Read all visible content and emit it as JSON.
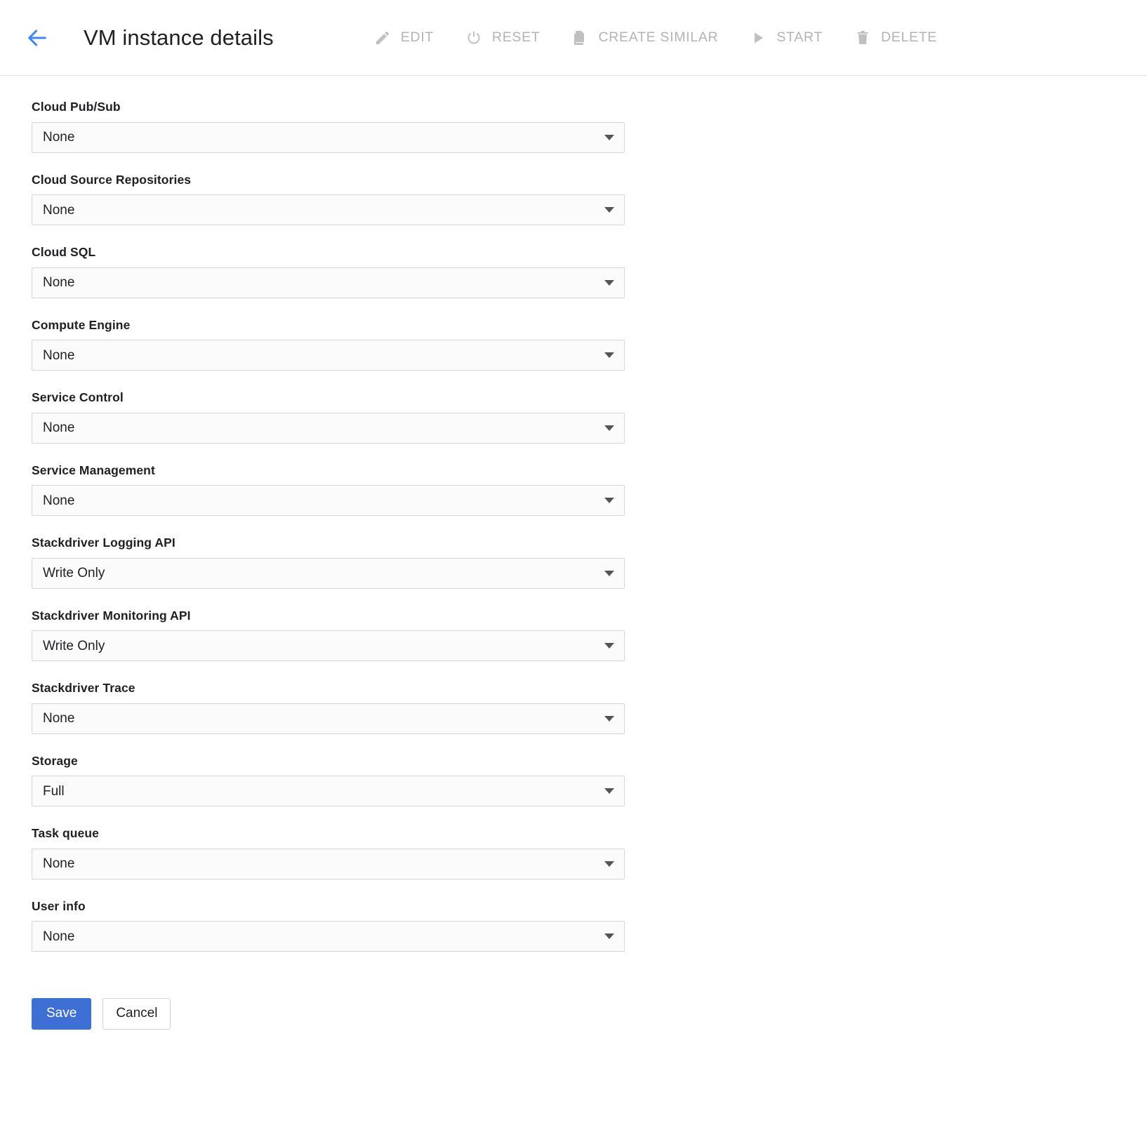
{
  "header": {
    "back_icon": "arrow-left-icon",
    "title": "VM instance details",
    "accent_color": "#4285f4",
    "toolbar_disabled_color": "#b4b4b4",
    "actions": [
      {
        "label": "EDIT",
        "icon": "pencil-icon",
        "disabled": true
      },
      {
        "label": "RESET",
        "icon": "power-reset-icon",
        "disabled": true
      },
      {
        "label": "CREATE SIMILAR",
        "icon": "duplicate-document-icon",
        "disabled": true
      },
      {
        "label": "START",
        "icon": "play-icon",
        "disabled": true
      },
      {
        "label": "DELETE",
        "icon": "trash-icon",
        "disabled": true
      }
    ]
  },
  "form": {
    "fields": [
      {
        "label": "Cloud Pub/Sub",
        "value": "None"
      },
      {
        "label": "Cloud Source Repositories",
        "value": "None"
      },
      {
        "label": "Cloud SQL",
        "value": "None"
      },
      {
        "label": "Compute Engine",
        "value": "None"
      },
      {
        "label": "Service Control",
        "value": "None"
      },
      {
        "label": "Service Management",
        "value": "None"
      },
      {
        "label": "Stackdriver Logging API",
        "value": "Write Only"
      },
      {
        "label": "Stackdriver Monitoring API",
        "value": "Write Only"
      },
      {
        "label": "Stackdriver Trace",
        "value": "None"
      },
      {
        "label": "Storage",
        "value": "Full"
      },
      {
        "label": "Task queue",
        "value": "None"
      },
      {
        "label": "User info",
        "value": "None"
      }
    ]
  },
  "footer": {
    "save_label": "Save",
    "cancel_label": "Cancel",
    "save_color": "#3d6fd4"
  }
}
